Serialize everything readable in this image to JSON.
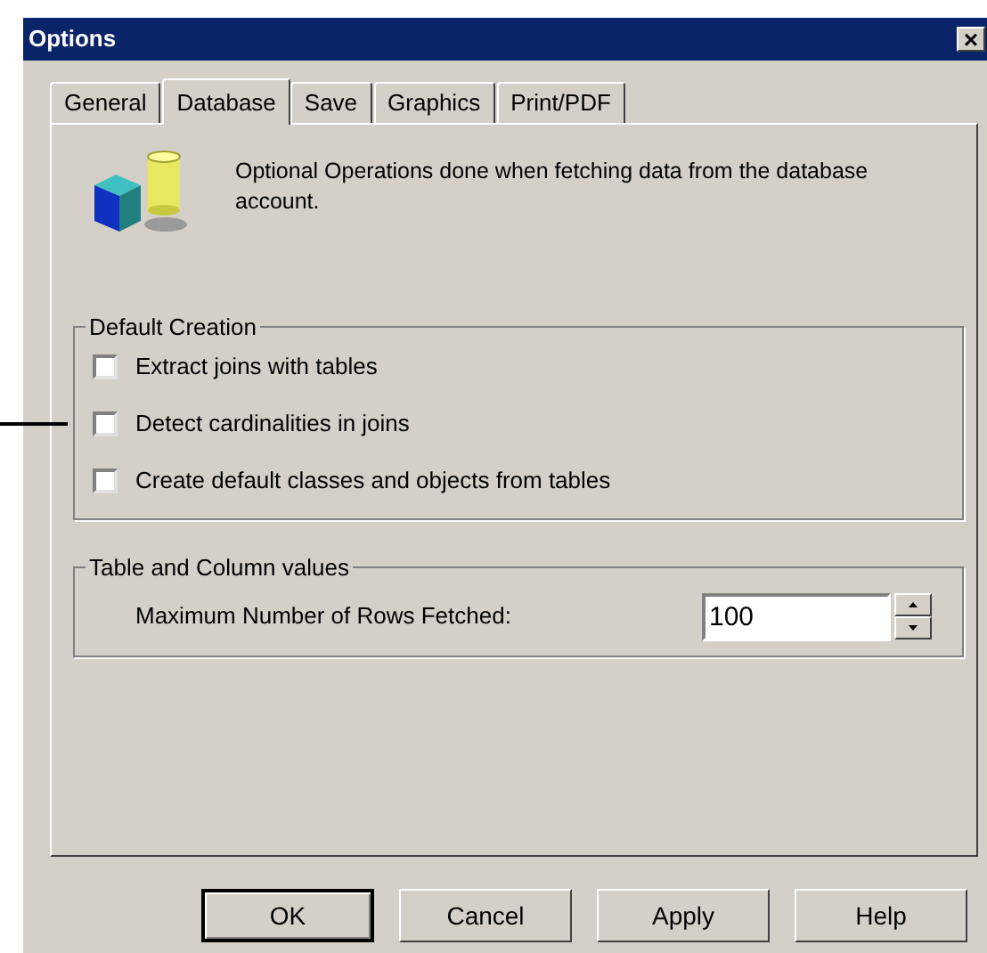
{
  "window": {
    "title": "Options",
    "close": "×"
  },
  "tabs": [
    {
      "label": "General",
      "selected": false
    },
    {
      "label": "Database",
      "selected": true
    },
    {
      "label": "Save",
      "selected": false
    },
    {
      "label": "Graphics",
      "selected": false
    },
    {
      "label": "Print/PDF",
      "selected": false
    }
  ],
  "description": "Optional Operations done when fetching data from the database account.",
  "default_creation": {
    "title": "Default Creation",
    "options": [
      {
        "label": "Extract joins with tables",
        "checked": false
      },
      {
        "label": "Detect cardinalities in joins",
        "checked": false
      },
      {
        "label": "Create default classes and objects from tables",
        "checked": false
      }
    ]
  },
  "table_column_values": {
    "title": "Table and Column values",
    "label": "Maximum Number of Rows Fetched:",
    "value": "100"
  },
  "buttons": [
    {
      "label": "OK",
      "default": true
    },
    {
      "label": "Cancel",
      "default": false
    },
    {
      "label": "Apply",
      "default": false
    },
    {
      "label": "Help",
      "default": false
    }
  ]
}
